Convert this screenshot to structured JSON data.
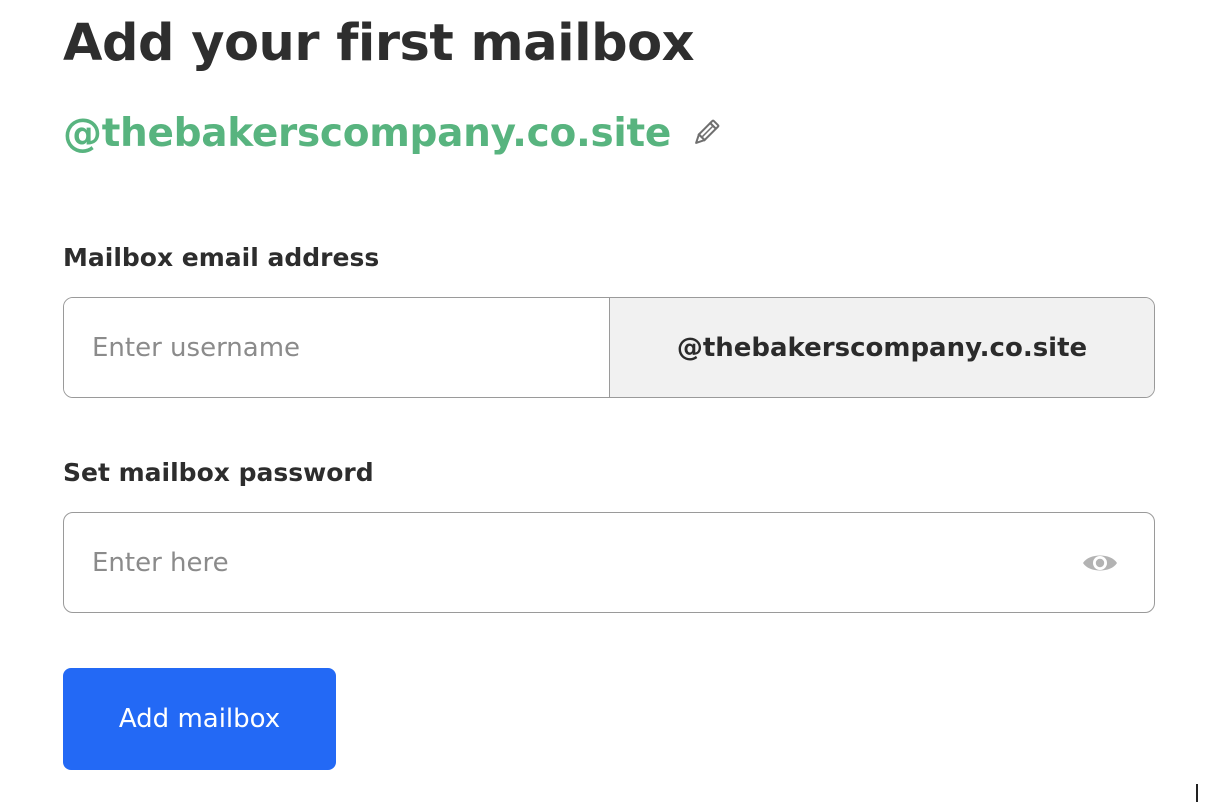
{
  "page": {
    "title": "Add your first mailbox",
    "domain": "@thebakerscompany.co.site"
  },
  "email_field": {
    "label": "Mailbox email address",
    "username_value": "",
    "username_placeholder": "Enter username",
    "domain_suffix": "@thebakerscompany.co.site"
  },
  "password_field": {
    "label": "Set mailbox password",
    "value": "",
    "placeholder": "Enter here",
    "toggle_icon": "eye-icon"
  },
  "actions": {
    "submit_label": "Add mailbox"
  },
  "icons": {
    "edit": "pencil-icon",
    "visibility": "eye-icon"
  },
  "colors": {
    "domain_accent": "#58b47f",
    "primary_button": "#2369f5",
    "suffix_background": "#f1f1f1",
    "border": "#9a9a9a"
  }
}
